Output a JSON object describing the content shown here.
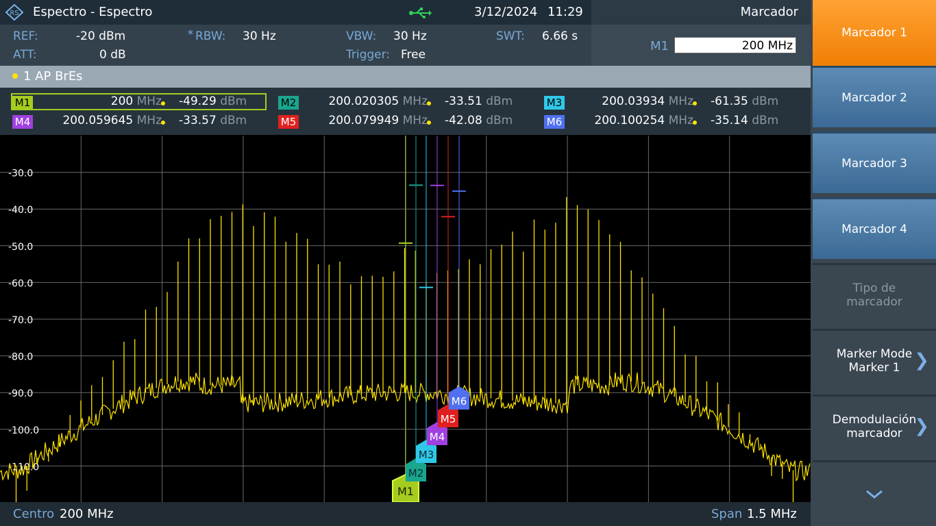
{
  "title": {
    "app": "Espectro - Espectro",
    "date": "3/12/2024",
    "time": "11:29",
    "usb_icon": "usb-icon",
    "logo_icon": "rs-logo-icon"
  },
  "softkey_header": "Marcador",
  "params": {
    "ref_label": "REF:",
    "ref_value": "-20 dBm",
    "att_label": "ATT:",
    "att_value": "0 dB",
    "rbw_marker": "*",
    "rbw_label": "RBW:",
    "rbw_value": "30 Hz",
    "vbw_label": "VBW:",
    "vbw_value": "30 Hz",
    "trigger_label": "Trigger:",
    "trigger_value": "Free",
    "swt_label": "SWT:",
    "swt_value": "6.66 s"
  },
  "marker_input": {
    "label": "M1",
    "value": "200 MHz"
  },
  "trace": {
    "text": "1 AP  BrEs",
    "color": "#ffe400"
  },
  "markers": [
    {
      "id": "M1",
      "freq": "200",
      "unit": "MHz",
      "level": "-49.29",
      "level_unit": "dBm",
      "color": "#a6cc1f",
      "text_color": "#000"
    },
    {
      "id": "M2",
      "freq": "200.020305",
      "unit": "MHz",
      "level": "-33.51",
      "level_unit": "dBm",
      "color": "#1aa58e",
      "text_color": "#000"
    },
    {
      "id": "M3",
      "freq": "200.03934",
      "unit": "MHz",
      "level": "-61.35",
      "level_unit": "dBm",
      "color": "#30c8e8",
      "text_color": "#000"
    },
    {
      "id": "M4",
      "freq": "200.059645",
      "unit": "MHz",
      "level": "-33.57",
      "level_unit": "dBm",
      "color": "#a040e0",
      "text_color": "#fff"
    },
    {
      "id": "M5",
      "freq": "200.079949",
      "unit": "MHz",
      "level": "-42.08",
      "level_unit": "dBm",
      "color": "#e02020",
      "text_color": "#fff"
    },
    {
      "id": "M6",
      "freq": "200.100254",
      "unit": "MHz",
      "level": "-35.14",
      "level_unit": "dBm",
      "color": "#5070f0",
      "text_color": "#fff"
    }
  ],
  "plot": {
    "y_ticks": [
      "-30.0",
      "-40.0",
      "-50.0",
      "-60.0",
      "-70.0",
      "-80.0",
      "-90.0",
      "-100.0",
      "-110.0"
    ],
    "y_values": [
      -30,
      -40,
      -50,
      -60,
      -70,
      -80,
      -90,
      -100,
      -110
    ],
    "trace_color": "#ffe400",
    "grid_color": "#6a6a6a"
  },
  "bottom": {
    "center_label": "Centro",
    "center_value": "200 MHz",
    "span_label": "Span",
    "span_value": "1.5 MHz"
  },
  "softkeys": [
    {
      "label": "Marcador 1",
      "state": "active"
    },
    {
      "label": "Marcador 2",
      "state": "normal"
    },
    {
      "label": "Marcador 3",
      "state": "normal"
    },
    {
      "label": "Marcador 4",
      "state": "normal"
    },
    {
      "label": "Tipo de marcador",
      "state": "disabled"
    },
    {
      "label": "Marker Mode Marker 1",
      "state": "submenu"
    },
    {
      "label": "Demodulación marcador",
      "state": "submenu"
    }
  ],
  "softkey_more_icon": "chevron-down-icon",
  "submenu_icon": "chevron-right-icon"
}
